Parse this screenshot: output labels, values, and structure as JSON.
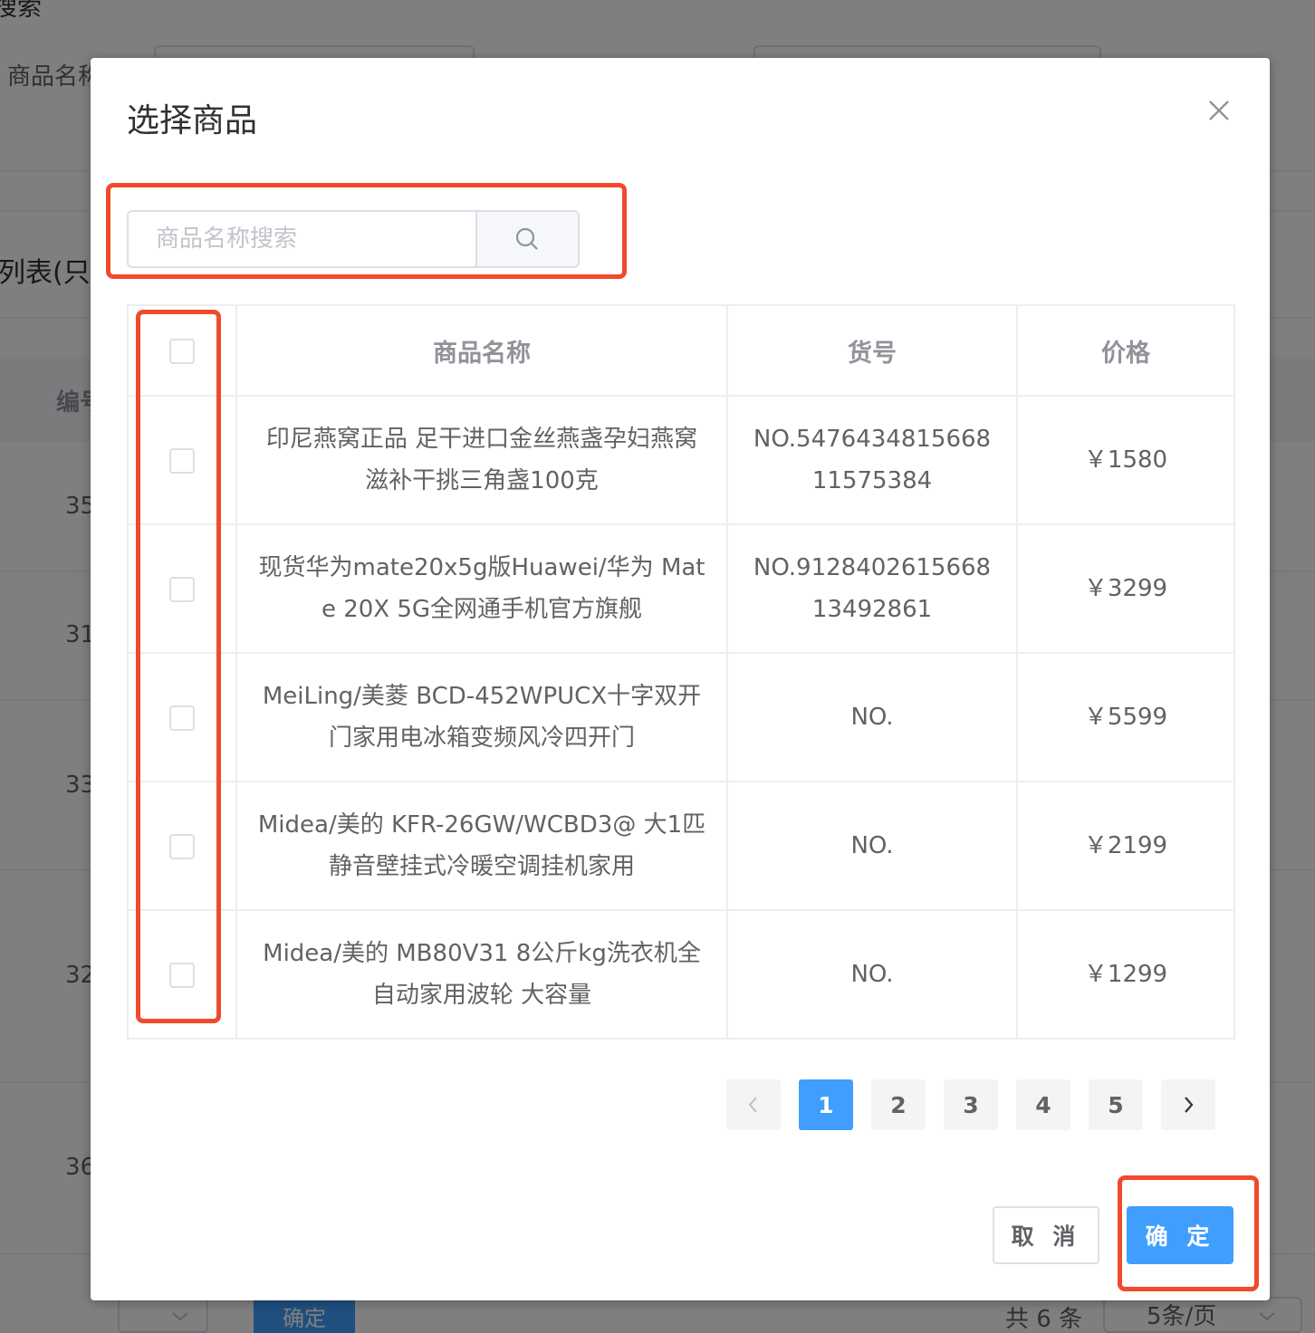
{
  "background": {
    "search_title": "搜索",
    "filter_label": "商品名称",
    "list_title": "列表(只",
    "col_id": "编号",
    "row_ids": [
      "35",
      "31",
      "33",
      "32",
      "36"
    ],
    "confirm_label": "确定",
    "total_text": "共 6 条",
    "page_size": "5条/页"
  },
  "dialog": {
    "title": "选择商品",
    "search": {
      "placeholder": "商品名称搜索",
      "value": ""
    },
    "table": {
      "headers": {
        "name": "商品名称",
        "sku": "货号",
        "price": "价格"
      },
      "rows": [
        {
          "name": "印尼燕窝正品 足干进口金丝燕盏孕妇燕窝滋补干挑三角盏100克",
          "sku": "NO.547643481566811575384",
          "price": "￥1580"
        },
        {
          "name": "现货华为mate20x5g版Huawei/华为 Mate 20X 5G全网通手机官方旗舰",
          "sku": "NO.912840261566813492861",
          "price": "￥3299"
        },
        {
          "name": "MeiLing/美菱 BCD-452WPUCX十字双开门家用电冰箱变频风冷四开门",
          "sku": "NO.",
          "price": "￥5599"
        },
        {
          "name": "Midea/美的 KFR-26GW/WCBD3@ 大1匹静音壁挂式冷暖空调挂机家用",
          "sku": "NO.",
          "price": "￥2199"
        },
        {
          "name": "Midea/美的 MB80V31 8公斤kg洗衣机全自动家用波轮 大容量",
          "sku": "NO.",
          "price": "￥1299"
        }
      ]
    },
    "pagination": {
      "current": "1",
      "pages": [
        "1",
        "2",
        "3",
        "4",
        "5"
      ]
    },
    "buttons": {
      "cancel": "取 消",
      "ok": "确 定"
    }
  },
  "colors": {
    "primary": "#409eff",
    "highlight_box": "#f04a2d",
    "overlay": "rgba(0,0,0,0.5)"
  },
  "icons": {
    "close": "close-icon",
    "search": "search-icon",
    "prev": "chevron-left-icon",
    "next": "chevron-right-icon",
    "select": "chevron-down-icon"
  }
}
